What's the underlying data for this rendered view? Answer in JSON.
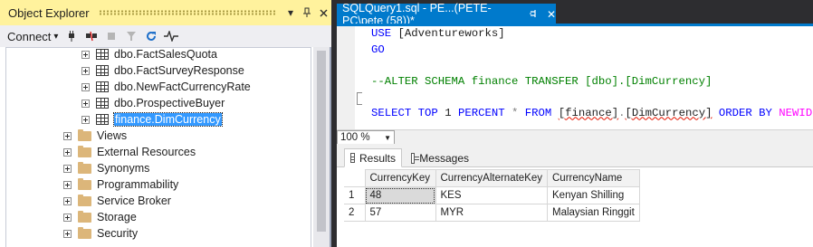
{
  "object_explorer": {
    "title": "Object Explorer",
    "toolbar": {
      "connect_label": "Connect",
      "dropdown_arrow": "▾"
    },
    "tree": [
      {
        "label": "dbo.FactSalesQuota",
        "type": "table",
        "level": 2,
        "selected": false
      },
      {
        "label": "dbo.FactSurveyResponse",
        "type": "table",
        "level": 2,
        "selected": false
      },
      {
        "label": "dbo.NewFactCurrencyRate",
        "type": "table",
        "level": 2,
        "selected": false
      },
      {
        "label": "dbo.ProspectiveBuyer",
        "type": "table",
        "level": 2,
        "selected": false
      },
      {
        "label": "finance.DimCurrency",
        "type": "table",
        "level": 2,
        "selected": true
      },
      {
        "label": "Views",
        "type": "folder",
        "level": 1,
        "selected": false
      },
      {
        "label": "External Resources",
        "type": "folder",
        "level": 1,
        "selected": false
      },
      {
        "label": "Synonyms",
        "type": "folder",
        "level": 1,
        "selected": false
      },
      {
        "label": "Programmability",
        "type": "folder",
        "level": 1,
        "selected": false
      },
      {
        "label": "Service Broker",
        "type": "folder",
        "level": 1,
        "selected": false
      },
      {
        "label": "Storage",
        "type": "folder",
        "level": 1,
        "selected": false
      },
      {
        "label": "Security",
        "type": "folder",
        "level": 1,
        "selected": false
      }
    ]
  },
  "editor": {
    "tab_title": "SQLQuery1.sql - PE...(PETE-PC\\pete (58))*",
    "pin_glyph": "⫯",
    "close_glyph": "✕",
    "code": {
      "line1_kw": "USE",
      "line1_rest": "[Adventureworks]",
      "line2_kw": "GO",
      "line4_comment": "--ALTER SCHEMA finance TRANSFER [dbo].[DimCurrency]",
      "line6_select": "SELECT TOP",
      "line6_num": "1",
      "line6_percent": "PERCENT",
      "line6_star": "*",
      "line6_from": "FROM",
      "line6_schema": "[finance]",
      "line6_dot": ".",
      "line6_table": "[DimCurrency]",
      "line6_orderby": "ORDER BY",
      "line6_fn": "NEWID",
      "line6_parens": "()"
    }
  },
  "zoom": {
    "value": "100 %"
  },
  "results": {
    "tabs": [
      {
        "label": "Results",
        "active": true
      },
      {
        "label": "Messages",
        "active": false
      }
    ],
    "columns": [
      "CurrencyKey",
      "CurrencyAlternateKey",
      "CurrencyName"
    ],
    "rows": [
      {
        "num": "1",
        "cells": [
          "48",
          "KES",
          "Kenyan Shilling"
        ]
      },
      {
        "num": "2",
        "cells": [
          "57",
          "MYR",
          "Malaysian Ringgit"
        ]
      }
    ]
  },
  "colors": {
    "accent": "#007acc",
    "panel_title_active": "#fff29d",
    "selection": "#3399ff",
    "keyword": "#0000ff",
    "comment": "#008000",
    "function": "#ff00ff"
  }
}
